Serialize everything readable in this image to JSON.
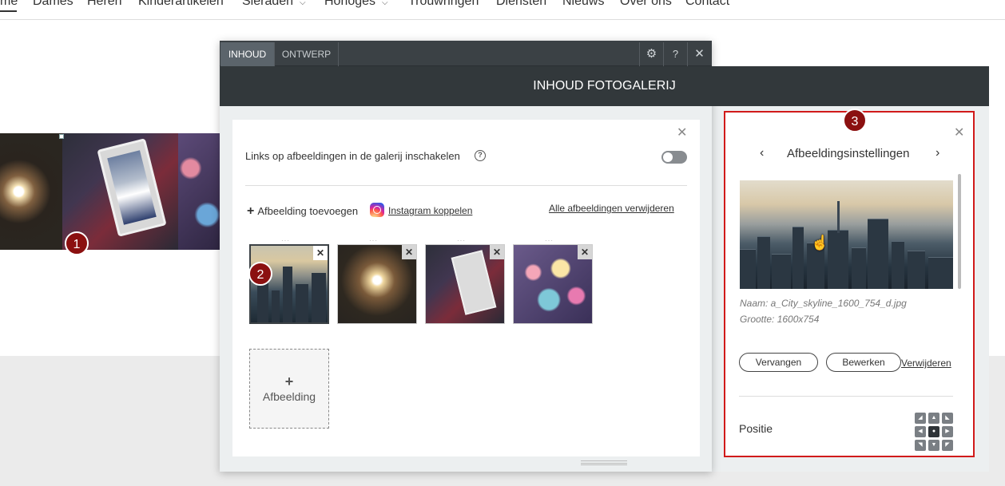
{
  "site_nav": {
    "items": [
      {
        "label": "me",
        "has_caret": false,
        "active": true
      },
      {
        "label": "Dames",
        "has_caret": false
      },
      {
        "label": "Heren",
        "has_caret": false
      },
      {
        "label": "Kinderartikelen",
        "has_caret": false
      },
      {
        "label": "Sieraden",
        "has_caret": true
      },
      {
        "label": "Horloges",
        "has_caret": true
      },
      {
        "label": "Trouwringen",
        "has_caret": false
      },
      {
        "label": "Diensten",
        "has_caret": false
      },
      {
        "label": "Nieuws",
        "has_caret": false
      },
      {
        "label": "Over ons",
        "has_caret": false
      },
      {
        "label": "Contact",
        "has_caret": false
      }
    ]
  },
  "badges": {
    "one": "1",
    "two": "2",
    "three": "3"
  },
  "editor": {
    "tabs": [
      {
        "label": "INHOUD",
        "active": true
      },
      {
        "label": "ONTWERP",
        "active": false
      }
    ],
    "tab_icons": [
      "gear-icon",
      "help-icon",
      "close-icon"
    ],
    "help_glyph": "?",
    "title": "INHOUD FOTOGALERIJ"
  },
  "content": {
    "links_label": "Links op afbeeldingen in de galerij inschakelen",
    "links_enabled": false,
    "add_image_label": "Afbeelding toevoegen",
    "instagram_label": "Instagram koppelen",
    "remove_all_label": "Alle afbeeldingen verwijderen",
    "thumbnails": [
      {
        "name": "city-skyline",
        "selected": true
      },
      {
        "name": "sparkler",
        "selected": false
      },
      {
        "name": "tablet",
        "selected": false
      },
      {
        "name": "bokeh",
        "selected": false
      }
    ],
    "add_tile_plus": "+",
    "add_tile_label": "Afbeelding"
  },
  "settings": {
    "title": "Afbeeldingsinstellingen",
    "name_line": "Naam: a_City_skyline_1600_754_d.jpg",
    "size_line": "Grootte: 1600x754",
    "replace_label": "Vervangen",
    "edit_label": "Bewerken",
    "delete_label": "Verwijderen",
    "position_label": "Positie",
    "position_selected": "center"
  },
  "colors": {
    "accent_red": "#d11a1a",
    "badge": "#8b1010",
    "toolbar": "#3b4145",
    "title_bar": "#32383b"
  }
}
